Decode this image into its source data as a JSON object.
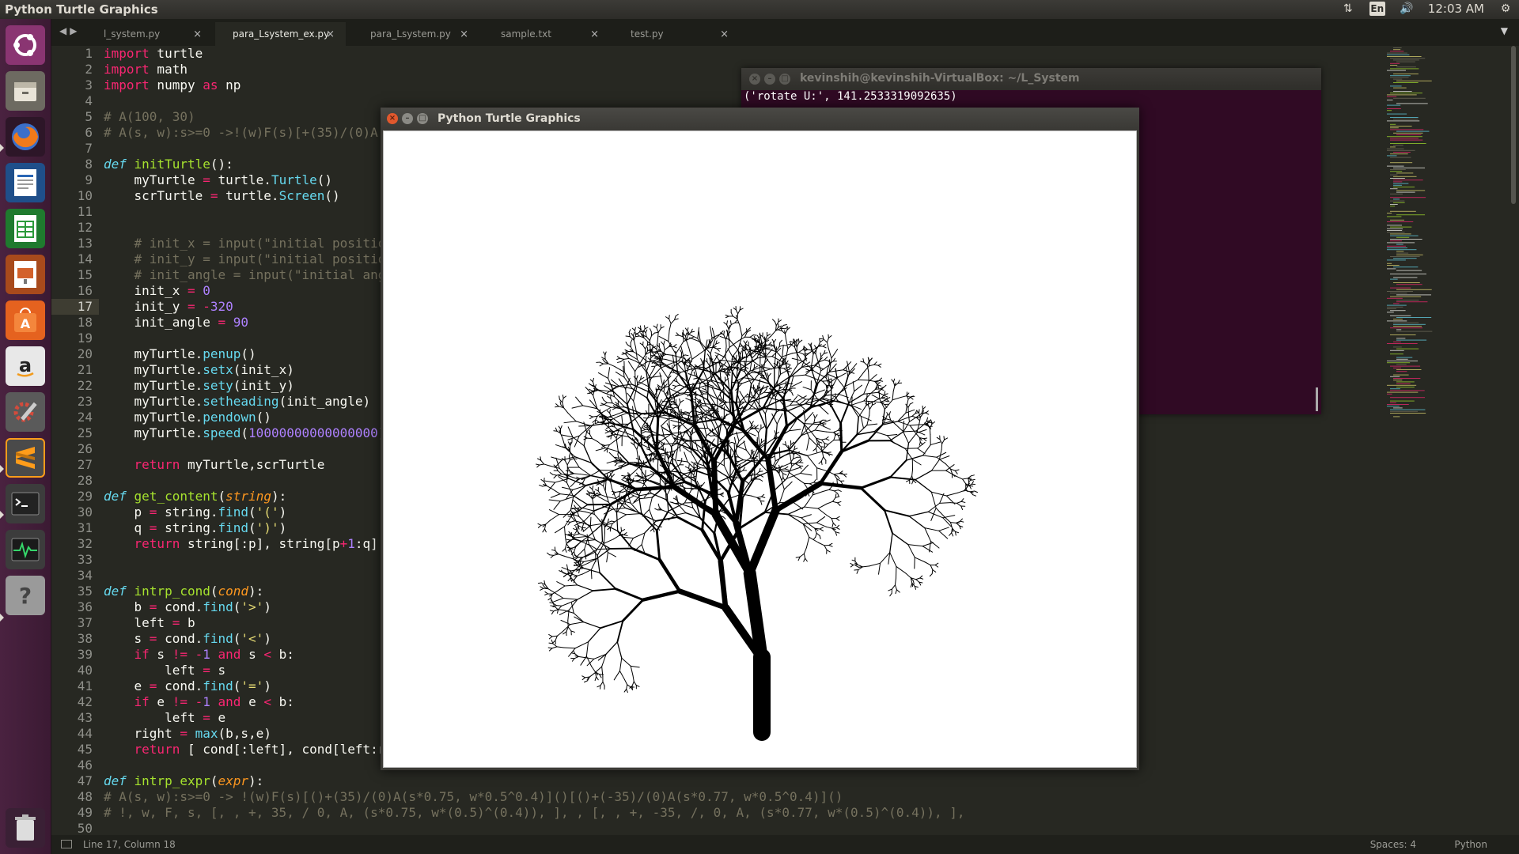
{
  "top_panel": {
    "title": "Python Turtle Graphics",
    "keyboard": "En",
    "clock": "12:03 AM"
  },
  "launcher": {
    "items": [
      "ubuntu-dash",
      "files",
      "firefox",
      "libreoffice-writer",
      "libreoffice-calc",
      "libreoffice-impress",
      "ubuntu-software",
      "amazon",
      "system-settings",
      "sublime-text",
      "terminal",
      "system-monitor",
      "help",
      "trash"
    ]
  },
  "tabs": [
    {
      "label": "l_system.py",
      "active": false
    },
    {
      "label": "para_Lsystem_ex.py",
      "active": true
    },
    {
      "label": "para_Lsystem.py",
      "active": false
    },
    {
      "label": "sample.txt",
      "active": false
    },
    {
      "label": "test.py",
      "active": false
    }
  ],
  "editor": {
    "current_line": 17,
    "line_numbers": [
      "1",
      "2",
      "3",
      "4",
      "5",
      "6",
      "7",
      "8",
      "9",
      "10",
      "11",
      "12",
      "13",
      "14",
      "15",
      "16",
      "17",
      "18",
      "19",
      "20",
      "21",
      "22",
      "23",
      "24",
      "25",
      "26",
      "27",
      "28",
      "29",
      "30",
      "31",
      "32",
      "33",
      "34",
      "35",
      "36",
      "37",
      "38",
      "39",
      "40",
      "41",
      "42",
      "43",
      "44",
      "45",
      "46",
      "47",
      "48",
      "49",
      "50"
    ]
  },
  "terminal": {
    "title": "kevinshih@kevinshih-VirtualBox: ~/L_System",
    "output": "('rotate U:', 141.2533319092635)"
  },
  "turtle_window": {
    "title": "Python Turtle Graphics"
  },
  "status_bar": {
    "position": "Line 17, Column 18",
    "spaces": "Spaces: 4",
    "syntax": "Python"
  }
}
